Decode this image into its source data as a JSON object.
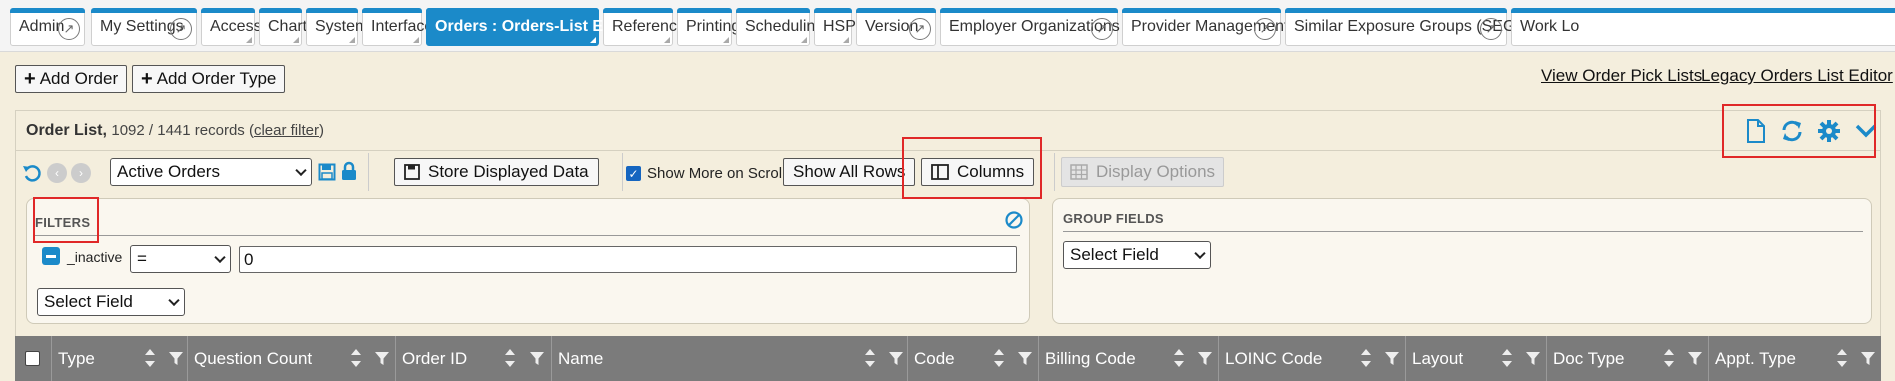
{
  "tabs": [
    {
      "label": "Admin",
      "ext": true
    },
    {
      "label": "My Settings",
      "ext": true
    },
    {
      "label": "Access",
      "ext": false
    },
    {
      "label": "Chart",
      "ext": false
    },
    {
      "label": "System",
      "ext": false
    },
    {
      "label": "Interface",
      "ext": false
    },
    {
      "label": "Orders : Orders-List Editor",
      "ext": false,
      "active": true
    },
    {
      "label": "Reference",
      "ext": false
    },
    {
      "label": "Printing",
      "ext": false
    },
    {
      "label": "Scheduling",
      "ext": false
    },
    {
      "label": "HSP",
      "ext": false
    },
    {
      "label": "Version",
      "ext": true
    },
    {
      "label": "Employer Organizations",
      "ext": true
    },
    {
      "label": "Provider Management",
      "ext": true
    },
    {
      "label": "Similar Exposure Groups (SEGs)",
      "ext": true
    },
    {
      "label": "Work Lo",
      "ext": false
    }
  ],
  "actions": {
    "add_order": "Add Order",
    "add_order_type": "Add Order Type",
    "view_pick_lists": "View Order Pick Lists",
    "legacy_editor": "Legacy Orders List Editor"
  },
  "panel": {
    "title": "Order List,",
    "count_text": "1092 / 1441 records (",
    "clear_filter": "clear filter",
    "count_close": ")"
  },
  "toolbar": {
    "view_select": "Active Orders",
    "store_data": "Store Displayed Data",
    "show_more_label": "Show More on Scroll",
    "show_more_checked": true,
    "show_all_rows": "Show All Rows",
    "columns": "Columns",
    "display_options": "Display Options"
  },
  "filters": {
    "title": "FILTERS",
    "field_name": "_inactive",
    "operator": "=",
    "value": "0",
    "select_field": "Select Field"
  },
  "group_fields": {
    "title": "GROUP FIELDS",
    "select_field": "Select Field"
  },
  "columns": [
    "Type",
    "Question Count",
    "Order ID",
    "Name",
    "Code",
    "Billing Code",
    "LOINC Code",
    "Layout",
    "Doc Type",
    "Appt. Type"
  ],
  "colors": {
    "tab_accent": "#1b8ac9",
    "icon_blue": "#1b8ac9",
    "highlight_red": "#e02828",
    "table_header": "#7b7b7b"
  }
}
